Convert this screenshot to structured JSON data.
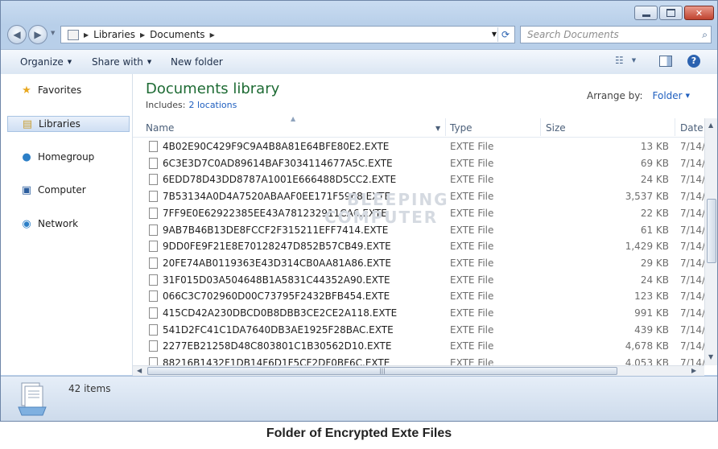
{
  "titlebar": {
    "minimize_icon": "minimize-icon",
    "maximize_icon": "maximize-icon",
    "close_label": "✕"
  },
  "address": {
    "breadcrumb": [
      "Libraries",
      "Documents"
    ],
    "search_placeholder": "Search Documents"
  },
  "toolbar": {
    "organize": "Organize",
    "share_with": "Share with",
    "new_folder": "New folder"
  },
  "sidebar": {
    "items": [
      {
        "label": "Favorites",
        "icon": "star-icon"
      },
      {
        "label": "Libraries",
        "icon": "libraries-icon",
        "selected": true
      },
      {
        "label": "Homegroup",
        "icon": "homegroup-icon"
      },
      {
        "label": "Computer",
        "icon": "computer-icon"
      },
      {
        "label": "Network",
        "icon": "network-icon"
      }
    ]
  },
  "library": {
    "title": "Documents library",
    "includes_label": "Includes:",
    "includes_link": "2 locations",
    "arrange_label": "Arrange by:",
    "arrange_value": "Folder"
  },
  "columns": {
    "name": "Name",
    "type": "Type",
    "size": "Size",
    "date": "Date"
  },
  "files": [
    {
      "name": "4B02E90C429F9C9A4B8A81E64BFE80E2.EXTE",
      "type": "EXTE File",
      "size": "13 KB",
      "date": "7/14/"
    },
    {
      "name": "6C3E3D7C0AD89614BAF3034114677A5C.EXTE",
      "type": "EXTE File",
      "size": "69 KB",
      "date": "7/14/"
    },
    {
      "name": "6EDD78D43DD8787A1001E666488D5CC2.EXTE",
      "type": "EXTE File",
      "size": "24 KB",
      "date": "7/14/"
    },
    {
      "name": "7B53134A0D4A7520ABAAF0EE171F5968.EXTE",
      "type": "EXTE File",
      "size": "3,537 KB",
      "date": "7/14/"
    },
    {
      "name": "7FF9E0E62922385EE43A781232911CA6.EXTE",
      "type": "EXTE File",
      "size": "22 KB",
      "date": "7/14/"
    },
    {
      "name": "9AB7B46B13DE8FCCF2F315211EFF7414.EXTE",
      "type": "EXTE File",
      "size": "61 KB",
      "date": "7/14/"
    },
    {
      "name": "9DD0FE9F21E8E70128247D852B57CB49.EXTE",
      "type": "EXTE File",
      "size": "1,429 KB",
      "date": "7/14/"
    },
    {
      "name": "20FE74AB0119363E43D314CB0AA81A86.EXTE",
      "type": "EXTE File",
      "size": "29 KB",
      "date": "7/14/"
    },
    {
      "name": "31F015D03A504648B1A5831C44352A90.EXTE",
      "type": "EXTE File",
      "size": "24 KB",
      "date": "7/14/"
    },
    {
      "name": "066C3C702960D00C73795F2432BFB454.EXTE",
      "type": "EXTE File",
      "size": "123 KB",
      "date": "7/14/"
    },
    {
      "name": "415CD42A230DBCD0B8DBB3CE2CE2A118.EXTE",
      "type": "EXTE File",
      "size": "991 KB",
      "date": "7/14/"
    },
    {
      "name": "541D2FC41C1DA7640DB3AE1925F28BAC.EXTE",
      "type": "EXTE File",
      "size": "439 KB",
      "date": "7/14/"
    },
    {
      "name": "2277EB21258D48C803801C1B30562D10.EXTE",
      "type": "EXTE File",
      "size": "4,678 KB",
      "date": "7/14/"
    },
    {
      "name": "88216B1432F1DB14F6D1F5CF2DF0BF6C.EXTE",
      "type": "EXTE File",
      "size": "4,053 KB",
      "date": "7/14/"
    }
  ],
  "watermark": [
    "BLEEPING",
    "COMPUTER"
  ],
  "status": {
    "item_count": "42 items"
  },
  "caption": "Folder of Encrypted Exte Files"
}
